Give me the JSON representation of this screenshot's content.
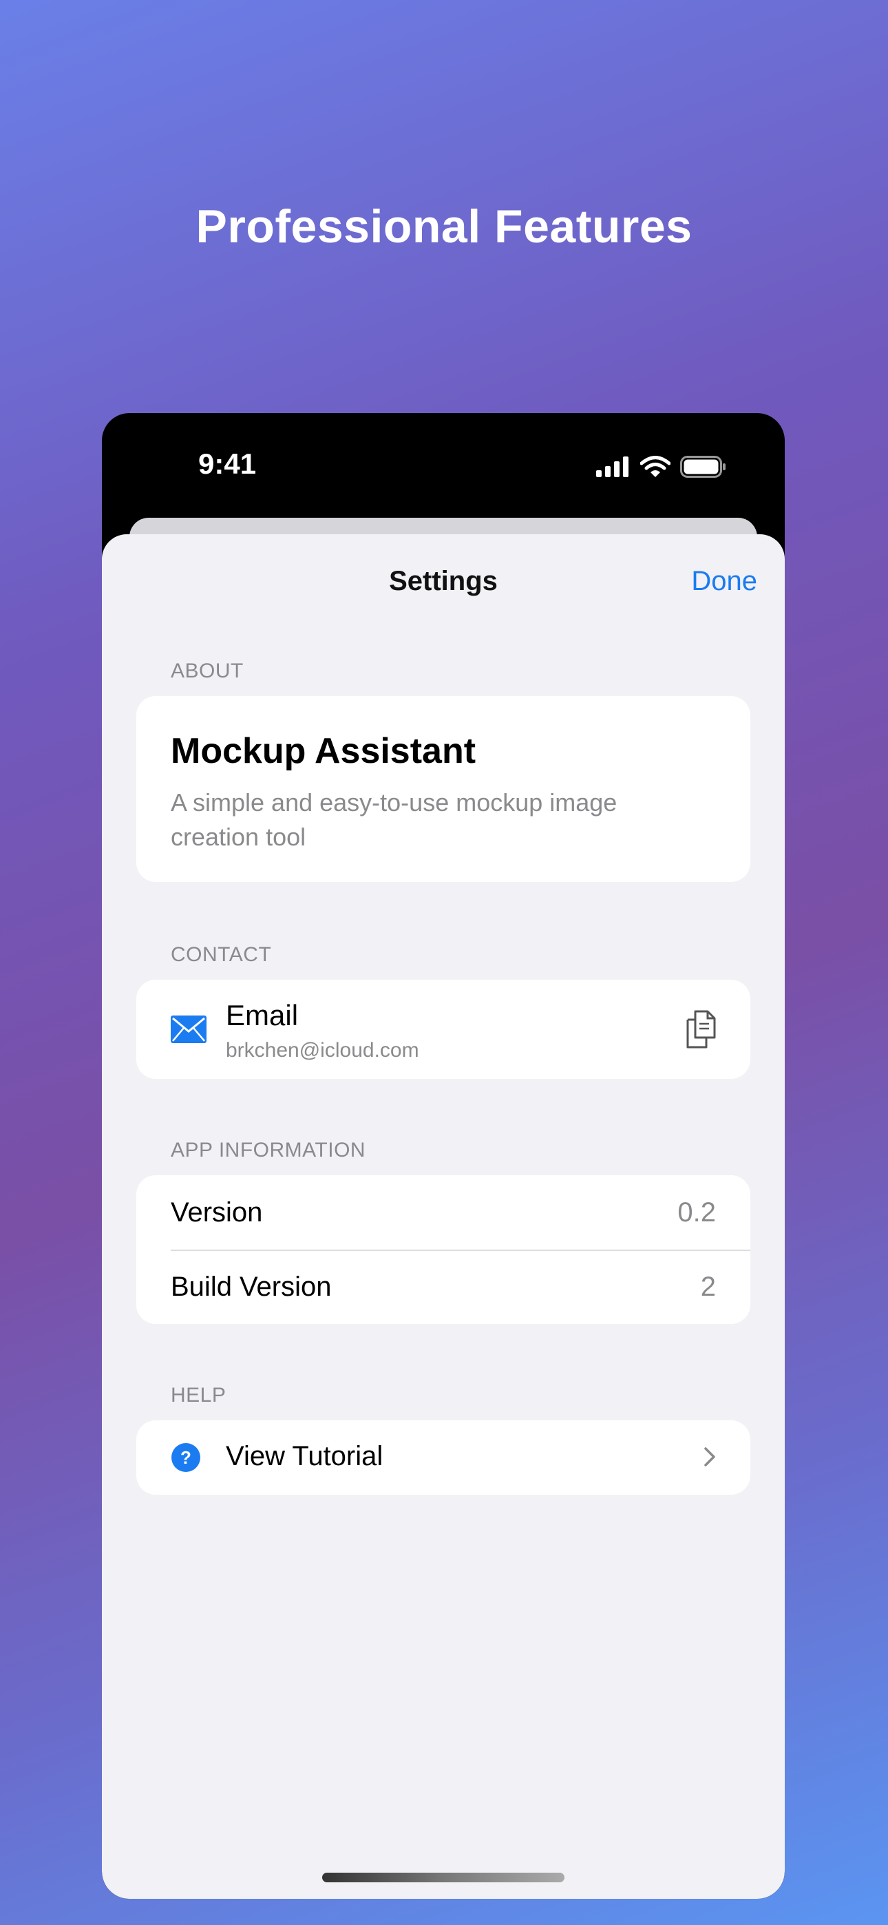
{
  "headline": "Professional Features",
  "status_bar": {
    "time": "9:41"
  },
  "nav": {
    "title": "Settings",
    "done_label": "Done"
  },
  "about": {
    "header": "ABOUT",
    "app_name": "Mockup Assistant",
    "description": "A simple and easy-to-use mockup image creation tool"
  },
  "contact": {
    "header": "CONTACT",
    "email_label": "Email",
    "email_value": "brkchen@icloud.com"
  },
  "app_info": {
    "header": "APP INFORMATION",
    "rows": [
      {
        "label": "Version",
        "value": "0.2"
      },
      {
        "label": "Build Version",
        "value": "2"
      }
    ]
  },
  "help": {
    "header": "HELP",
    "tutorial_label": "View Tutorial"
  },
  "colors": {
    "accent": "#1a7cf0",
    "secondary_text": "#8a8a8e",
    "sheet_bg": "#f2f1f6"
  },
  "icons": {
    "email": "envelope-icon",
    "copy": "copy-icon",
    "help": "question-circle-icon",
    "chevron": "chevron-right-icon"
  }
}
